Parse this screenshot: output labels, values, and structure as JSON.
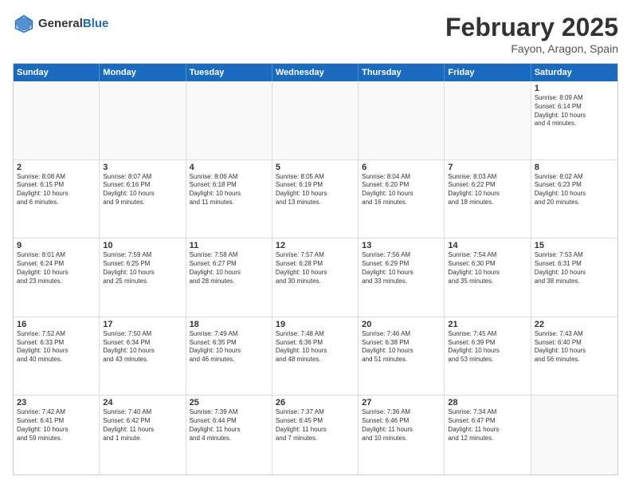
{
  "logo": {
    "general": "General",
    "blue": "Blue"
  },
  "header": {
    "month": "February 2025",
    "location": "Fayon, Aragon, Spain"
  },
  "weekdays": [
    "Sunday",
    "Monday",
    "Tuesday",
    "Wednesday",
    "Thursday",
    "Friday",
    "Saturday"
  ],
  "weeks": [
    [
      {
        "day": "",
        "info": ""
      },
      {
        "day": "",
        "info": ""
      },
      {
        "day": "",
        "info": ""
      },
      {
        "day": "",
        "info": ""
      },
      {
        "day": "",
        "info": ""
      },
      {
        "day": "",
        "info": ""
      },
      {
        "day": "1",
        "info": "Sunrise: 8:09 AM\nSunset: 6:14 PM\nDaylight: 10 hours\nand 4 minutes."
      }
    ],
    [
      {
        "day": "2",
        "info": "Sunrise: 8:08 AM\nSunset: 6:15 PM\nDaylight: 10 hours\nand 6 minutes."
      },
      {
        "day": "3",
        "info": "Sunrise: 8:07 AM\nSunset: 6:16 PM\nDaylight: 10 hours\nand 9 minutes."
      },
      {
        "day": "4",
        "info": "Sunrise: 8:06 AM\nSunset: 6:18 PM\nDaylight: 10 hours\nand 11 minutes."
      },
      {
        "day": "5",
        "info": "Sunrise: 8:05 AM\nSunset: 6:19 PM\nDaylight: 10 hours\nand 13 minutes."
      },
      {
        "day": "6",
        "info": "Sunrise: 8:04 AM\nSunset: 6:20 PM\nDaylight: 10 hours\nand 16 minutes."
      },
      {
        "day": "7",
        "info": "Sunrise: 8:03 AM\nSunset: 6:22 PM\nDaylight: 10 hours\nand 18 minutes."
      },
      {
        "day": "8",
        "info": "Sunrise: 8:02 AM\nSunset: 6:23 PM\nDaylight: 10 hours\nand 20 minutes."
      }
    ],
    [
      {
        "day": "9",
        "info": "Sunrise: 8:01 AM\nSunset: 6:24 PM\nDaylight: 10 hours\nand 23 minutes."
      },
      {
        "day": "10",
        "info": "Sunrise: 7:59 AM\nSunset: 6:25 PM\nDaylight: 10 hours\nand 25 minutes."
      },
      {
        "day": "11",
        "info": "Sunrise: 7:58 AM\nSunset: 6:27 PM\nDaylight: 10 hours\nand 28 minutes."
      },
      {
        "day": "12",
        "info": "Sunrise: 7:57 AM\nSunset: 6:28 PM\nDaylight: 10 hours\nand 30 minutes."
      },
      {
        "day": "13",
        "info": "Sunrise: 7:56 AM\nSunset: 6:29 PM\nDaylight: 10 hours\nand 33 minutes."
      },
      {
        "day": "14",
        "info": "Sunrise: 7:54 AM\nSunset: 6:30 PM\nDaylight: 10 hours\nand 35 minutes."
      },
      {
        "day": "15",
        "info": "Sunrise: 7:53 AM\nSunset: 6:31 PM\nDaylight: 10 hours\nand 38 minutes."
      }
    ],
    [
      {
        "day": "16",
        "info": "Sunrise: 7:52 AM\nSunset: 6:33 PM\nDaylight: 10 hours\nand 40 minutes."
      },
      {
        "day": "17",
        "info": "Sunrise: 7:50 AM\nSunset: 6:34 PM\nDaylight: 10 hours\nand 43 minutes."
      },
      {
        "day": "18",
        "info": "Sunrise: 7:49 AM\nSunset: 6:35 PM\nDaylight: 10 hours\nand 46 minutes."
      },
      {
        "day": "19",
        "info": "Sunrise: 7:48 AM\nSunset: 6:36 PM\nDaylight: 10 hours\nand 48 minutes."
      },
      {
        "day": "20",
        "info": "Sunrise: 7:46 AM\nSunset: 6:38 PM\nDaylight: 10 hours\nand 51 minutes."
      },
      {
        "day": "21",
        "info": "Sunrise: 7:45 AM\nSunset: 6:39 PM\nDaylight: 10 hours\nand 53 minutes."
      },
      {
        "day": "22",
        "info": "Sunrise: 7:43 AM\nSunset: 6:40 PM\nDaylight: 10 hours\nand 56 minutes."
      }
    ],
    [
      {
        "day": "23",
        "info": "Sunrise: 7:42 AM\nSunset: 6:41 PM\nDaylight: 10 hours\nand 59 minutes."
      },
      {
        "day": "24",
        "info": "Sunrise: 7:40 AM\nSunset: 6:42 PM\nDaylight: 11 hours\nand 1 minute."
      },
      {
        "day": "25",
        "info": "Sunrise: 7:39 AM\nSunset: 6:44 PM\nDaylight: 11 hours\nand 4 minutes."
      },
      {
        "day": "26",
        "info": "Sunrise: 7:37 AM\nSunset: 6:45 PM\nDaylight: 11 hours\nand 7 minutes."
      },
      {
        "day": "27",
        "info": "Sunrise: 7:36 AM\nSunset: 6:46 PM\nDaylight: 11 hours\nand 10 minutes."
      },
      {
        "day": "28",
        "info": "Sunrise: 7:34 AM\nSunset: 6:47 PM\nDaylight: 11 hours\nand 12 minutes."
      },
      {
        "day": "",
        "info": ""
      }
    ]
  ]
}
